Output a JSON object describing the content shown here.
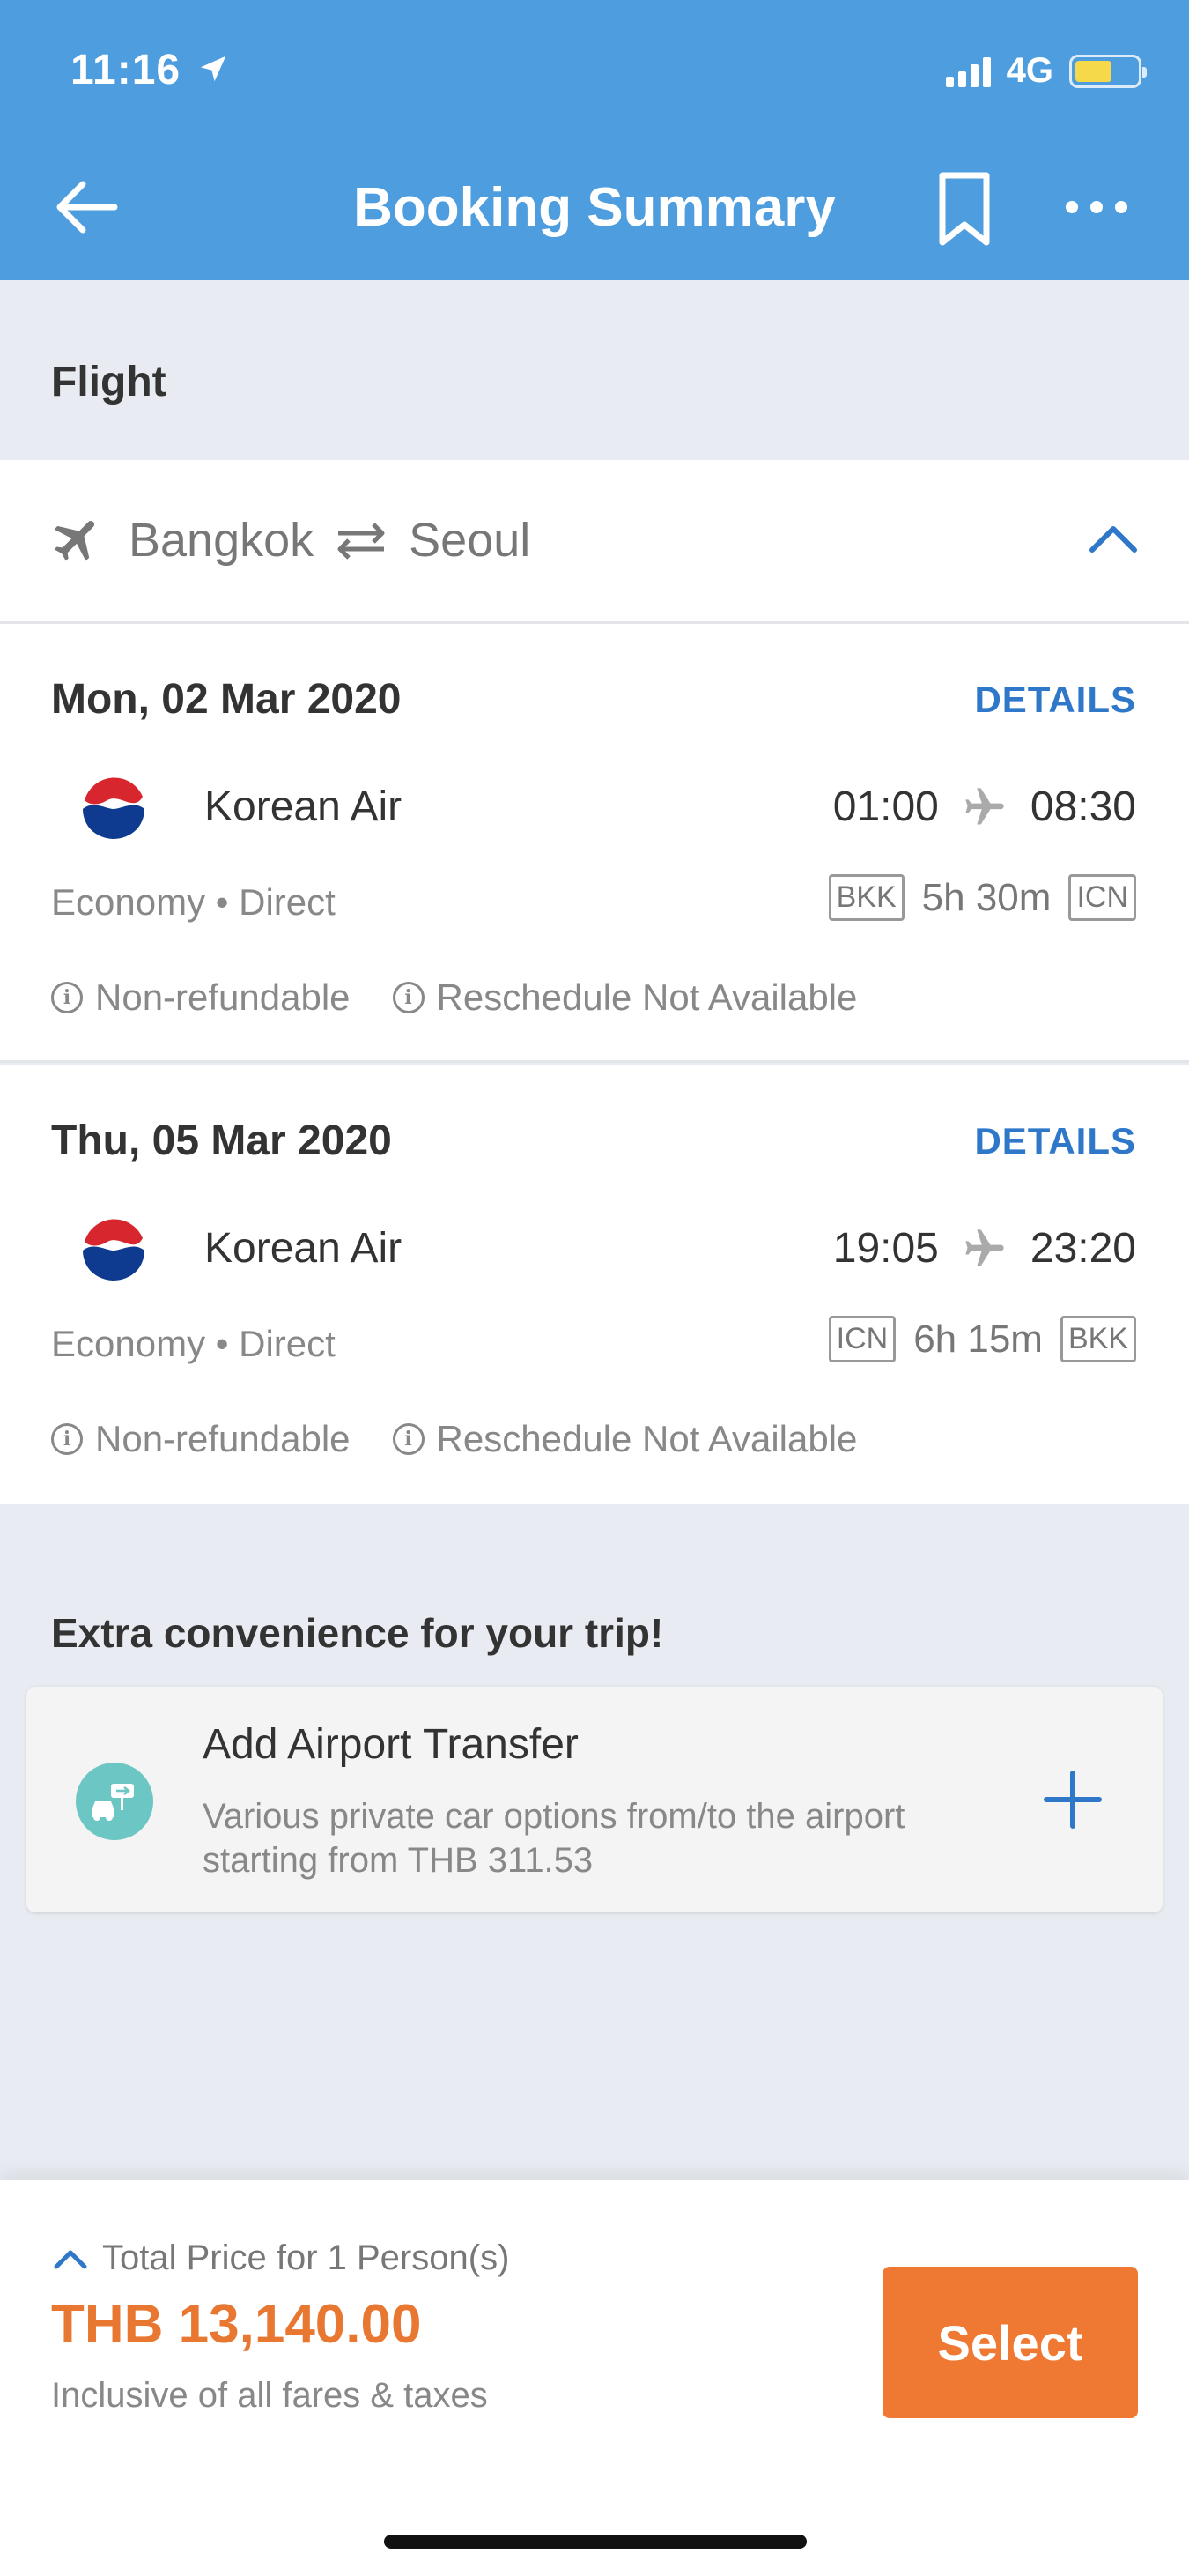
{
  "status_bar": {
    "time": "11:16",
    "network": "4G"
  },
  "header": {
    "title": "Booking Summary"
  },
  "section": {
    "label": "Flight"
  },
  "route": {
    "origin": "Bangkok",
    "destination": "Seoul"
  },
  "flights": [
    {
      "date": "Mon, 02 Mar 2020",
      "details_label": "DETAILS",
      "airline": "Korean Air",
      "depart_time": "01:00",
      "arrive_time": "08:30",
      "cabin": "Economy • Direct",
      "origin_code": "BKK",
      "duration": "5h 30m",
      "dest_code": "ICN",
      "policy_1": "Non-refundable",
      "policy_2": "Reschedule Not Available"
    },
    {
      "date": "Thu, 05 Mar 2020",
      "details_label": "DETAILS",
      "airline": "Korean Air",
      "depart_time": "19:05",
      "arrive_time": "23:20",
      "cabin": "Economy • Direct",
      "origin_code": "ICN",
      "duration": "6h 15m",
      "dest_code": "BKK",
      "policy_1": "Non-refundable",
      "policy_2": "Reschedule Not Available"
    }
  ],
  "extras": {
    "title": "Extra convenience for your trip!",
    "transfer_title": "Add Airport Transfer",
    "transfer_desc": "Various private car options from/to the airport starting from THB 311.53"
  },
  "bottom": {
    "total_label": "Total Price for 1 Person(s)",
    "price": "THB 13,140.00",
    "note": "Inclusive of all fares & taxes",
    "select_label": "Select"
  },
  "colors": {
    "header_bg": "#4d9ddf",
    "accent_blue": "#2f78c9",
    "price_orange": "#e87731",
    "select_button": "#ef7932",
    "battery": "#f6d94a"
  }
}
